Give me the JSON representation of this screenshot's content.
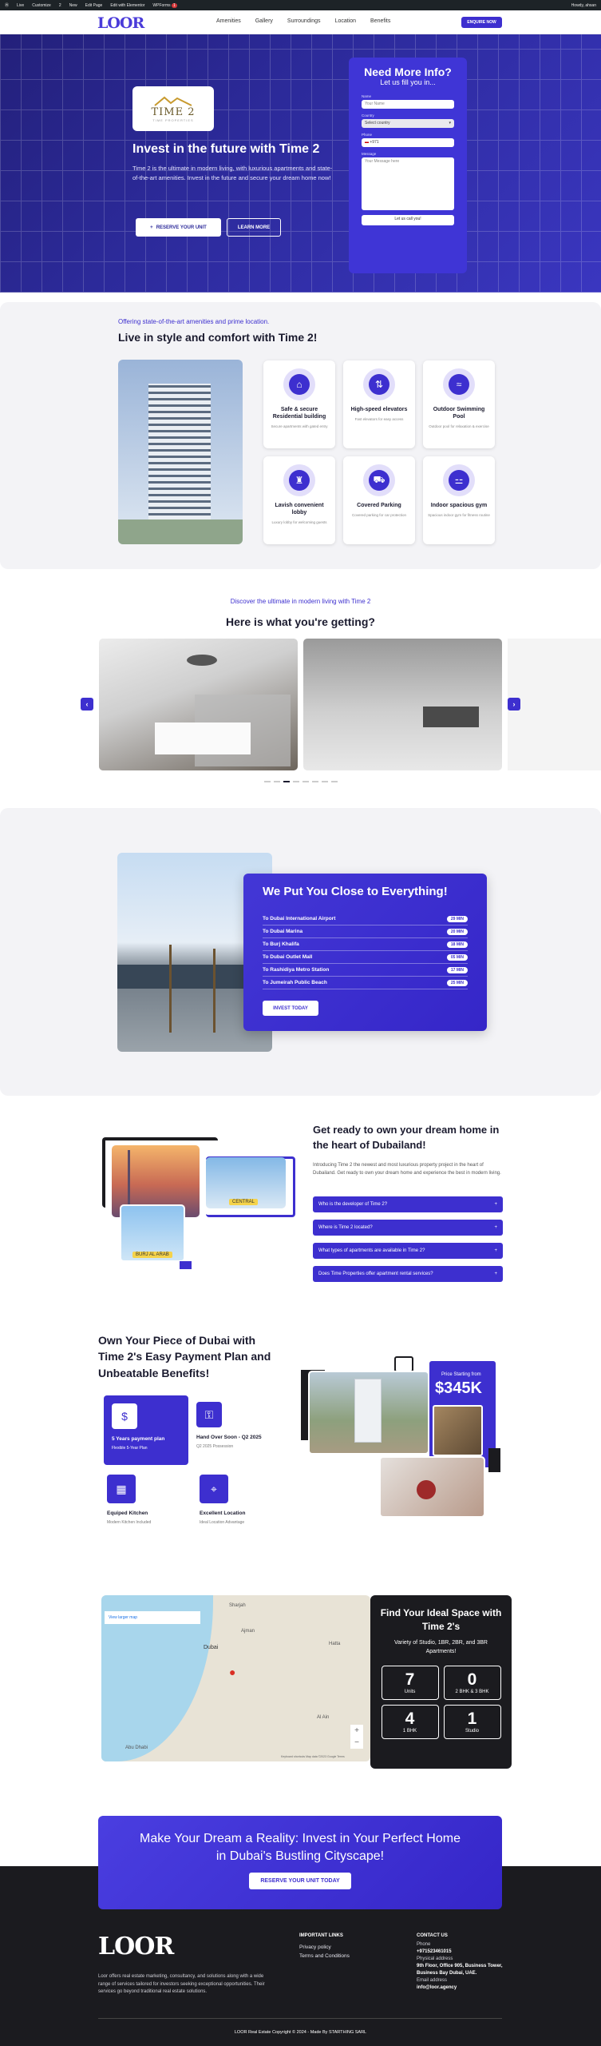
{
  "admin_bar": {
    "items": [
      "Live",
      "Customize",
      "2",
      "New",
      "Edit Page",
      "Edit with Elementor",
      "WPForms"
    ],
    "wpforms_count": "1",
    "greeting": "Howdy, ahsan"
  },
  "header": {
    "logo": "LOOR",
    "nav": [
      "Amenities",
      "Gallery",
      "Surroundings",
      "Location",
      "Benefits"
    ],
    "cta": "ENQUIRE NOW"
  },
  "hero": {
    "brand_title": "TIME 2",
    "brand_sub": "TIME PROPERTIES",
    "title": "Invest in the future with Time 2",
    "text": "Time 2 is the ultimate in modern living, with luxurious apartments and state-of-the-art amenities. Invest in the future and secure your dream home now!",
    "btn_reserve": "RESERVE YOUR UNIT",
    "btn_learn": "LEARN MORE"
  },
  "form": {
    "title": "Need More Info?",
    "subtitle": "Let us fill you in...",
    "name_label": "Name",
    "name_placeholder": "Your Name",
    "country_label": "Country",
    "country_value": "Select country",
    "phone_label": "Phone",
    "phone_code": "+971",
    "message_label": "Message",
    "message_placeholder": "Your Message here",
    "submit": "Let us call you!"
  },
  "amenities": {
    "eyebrow": "Offering state-of-the-art amenities and prime location.",
    "title": "Live in style and comfort with Time 2!",
    "items": [
      {
        "title": "Safe & secure Residential building",
        "desc": "Secure apartments with gated entry",
        "icon": "house-icon"
      },
      {
        "title": "High-speed elevators",
        "desc": "Fast elevators for easy access",
        "icon": "elevator-icon"
      },
      {
        "title": "Outdoor Swimming Pool",
        "desc": "Outdoor pool for relaxation & exercise",
        "icon": "pool-icon"
      },
      {
        "title": "Lavish convenient lobby",
        "desc": "Luxury lobby for welcoming guests",
        "icon": "lobby-icon"
      },
      {
        "title": "Covered Parking",
        "desc": "Covered parking for car protection",
        "icon": "car-icon"
      },
      {
        "title": "Indoor spacious gym",
        "desc": "Spacious indoor gym for fitness routine",
        "icon": "dumbbell-icon"
      }
    ]
  },
  "gallery": {
    "eyebrow": "Discover the ultimate in modern living with Time 2",
    "title": "Here is what you're getting?",
    "dots": 8,
    "active_dot": 2
  },
  "location": {
    "title": "We Put You Close to Everything!",
    "rows": [
      {
        "place": "To Dubai International Airport",
        "time": "29 MIN"
      },
      {
        "place": "To Dubai Marina",
        "time": "20 MIN"
      },
      {
        "place": "To Burj Khalifa",
        "time": "18 MIN"
      },
      {
        "place": "To Dubai Outlet Mall",
        "time": "05 MIN"
      },
      {
        "place": "To Rashidiya Metro Station",
        "time": "17 MIN"
      },
      {
        "place": "To Jumeirah Public Beach",
        "time": "25 MIN"
      }
    ],
    "cta": "INVEST TODAY"
  },
  "faq": {
    "title": "Get ready to own your dream home in the heart of Dubailand!",
    "text": "Introducing Time 2 the newest and most luxurious property project in the heart of Dubailand. Get ready to own your dream home and experience the best in modern living.",
    "questions": [
      "Who is the developer of Time 2?",
      "Where is Time 2 located?",
      "What types of apartments are available in Time 2?",
      "Does Time Properties offer apartment rental services?"
    ],
    "tags": [
      "CENTRAL",
      "BURJ AL ARAB"
    ]
  },
  "benefits": {
    "title": "Own Your Piece of Dubai with Time 2's Easy Payment Plan and Unbeatable Benefits!",
    "items": [
      {
        "title": "5 Years payment plan",
        "desc": "Flexible 5-Year Plan",
        "icon": "payment-icon"
      },
      {
        "title": "Hand Over Soon - Q2 2025",
        "desc": "Q2 2025 Possession",
        "icon": "key-icon"
      },
      {
        "title": "Equiped Kitchen",
        "desc": "Modern Kitchen Included",
        "icon": "kitchen-icon"
      },
      {
        "title": "Excellent Location",
        "desc": "Ideal Location Advantage",
        "icon": "map-pin-icon"
      }
    ],
    "price_label": "Price Starting from",
    "price": "$345K"
  },
  "units": {
    "map_link": "View larger map",
    "map_labels": [
      "Sharjah",
      "Ajman",
      "Dubai",
      "Hatta",
      "Al Ain",
      "Abu Dhabi"
    ],
    "map_footer": "Keyboard shortcuts   Map data ©2023 Google   Terms",
    "title": "Find Your Ideal Space with Time 2's",
    "subtitle": "Variety of Studio, 1BR, 2BR, and 3BR Apartments!",
    "stats": [
      {
        "num": "7",
        "label": "Units"
      },
      {
        "num": "0",
        "label": "2 BHK & 3 BHK"
      },
      {
        "num": "4",
        "label": "1 BHK"
      },
      {
        "num": "1",
        "label": "Studio"
      }
    ]
  },
  "cta_banner": {
    "title": "Make Your Dream a Reality: Invest in Your Perfect Home in Dubai's Bustling Cityscape!",
    "button": "RESERVE YOUR UNIT TODAY"
  },
  "footer": {
    "logo": "LOOR",
    "about": "Loor offers real estate marketing, consultancy, and solutions along with a wide range of services tailored for investors seeking exceptional opportunities. Their services go beyond traditional real estate solutions.",
    "links_title": "IMPORTANT LINKS",
    "links": [
      "Privacy policy",
      "Terms and Conditions"
    ],
    "contact_title": "CONTACT US",
    "phone_label": "Phone",
    "phone": "+971523461015",
    "address_label": "Physical address",
    "address": "9th Floor, Office 905, Business Tower, Business Bay Dubai, UAE.",
    "email_label": "Email address",
    "email": "info@loor.agency",
    "copyright": "LOOR Real Estate Copyright © 2024 - Made By STARTHING SARL"
  },
  "colors": {
    "primary": "#3d2fcf",
    "dark": "#1b1b1f",
    "hero": "#2c2a9a"
  }
}
